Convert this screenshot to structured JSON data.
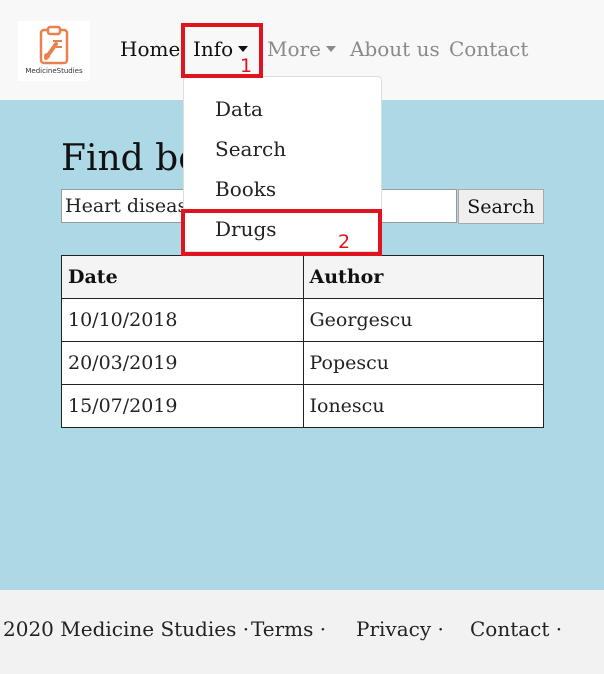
{
  "brand": {
    "logo_text": "MedicineStudies"
  },
  "nav": {
    "home": "Home",
    "info": "Info",
    "more": "More",
    "about": "About us",
    "contact": "Contact"
  },
  "dropdown": {
    "items": [
      "Data",
      "Search",
      "Books",
      "Drugs"
    ]
  },
  "main": {
    "title": "Find books",
    "search_value": "Heart disease",
    "search_button": "Search"
  },
  "table": {
    "headers": [
      "Date",
      "Author"
    ],
    "rows": [
      [
        "10/10/2018",
        "Georgescu"
      ],
      [
        "20/03/2019",
        "Popescu"
      ],
      [
        "15/07/2019",
        "Ionescu"
      ]
    ]
  },
  "annotations": {
    "marker_1": "1",
    "marker_2": "2"
  },
  "footer": {
    "copyright": "2020 Medicine Studies ·",
    "terms": "Terms ·",
    "privacy": "Privacy ·",
    "contact": "Contact ·"
  },
  "colors": {
    "content_bg": "#add8e6",
    "highlight": "#e0141e",
    "logo_accent": "#e8814d"
  }
}
